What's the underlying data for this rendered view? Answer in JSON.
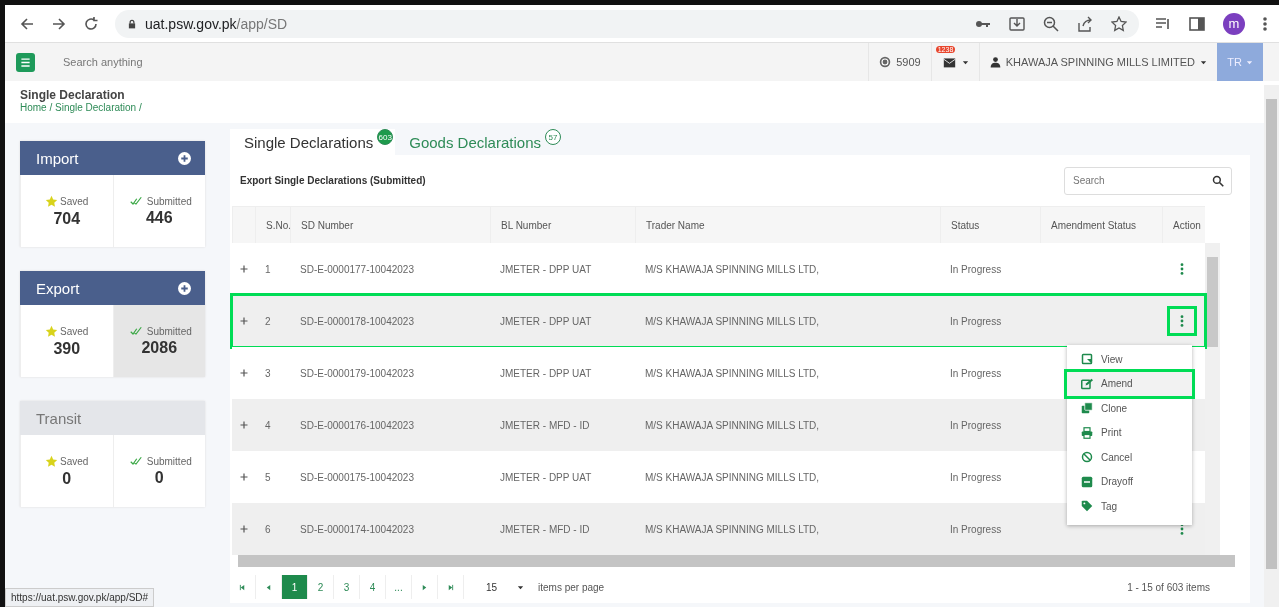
{
  "browser": {
    "url": {
      "host": "uat.psw.gov.pk",
      "path": "/app/SD"
    },
    "avatar": "m"
  },
  "header": {
    "search_placeholder": "Search anything",
    "points": "5909",
    "mail_badge": "1238",
    "user": "KHAWAJA SPINNING MILLS LIMITED",
    "language": "TR"
  },
  "page": {
    "title": "Single Declaration",
    "breadcrumb": "Home / Single Declaration /"
  },
  "sidebar": [
    {
      "title": "Import",
      "enabled": true,
      "stats": [
        {
          "label": "Saved",
          "value": "704",
          "selected": false
        },
        {
          "label": "Submitted",
          "value": "446",
          "selected": false
        }
      ]
    },
    {
      "title": "Export",
      "enabled": true,
      "stats": [
        {
          "label": "Saved",
          "value": "390",
          "selected": false
        },
        {
          "label": "Submitted",
          "value": "2086",
          "selected": true
        }
      ]
    },
    {
      "title": "Transit",
      "enabled": false,
      "stats": [
        {
          "label": "Saved",
          "value": "0",
          "selected": false
        },
        {
          "label": "Submitted",
          "value": "0",
          "selected": false
        }
      ]
    }
  ],
  "tabs": [
    {
      "label": "Single Declarations",
      "badge": "603",
      "selected": true
    },
    {
      "label": "Goods Declarations",
      "badge": "57",
      "selected": false
    }
  ],
  "table": {
    "title": "Export Single Declarations (Submitted)",
    "search_placeholder": "Search",
    "columns": [
      "S.No.",
      "SD Number",
      "BL Number",
      "Trader Name",
      "Status",
      "Amendment Status",
      "Action"
    ],
    "rows": [
      {
        "sno": "1",
        "sd_number": "SD-E-0000177-10042023",
        "bl_number": "JMETER - DPP UAT",
        "trader_name": "M/S KHAWAJA SPINNING MILLS LTD,",
        "status": "In Progress",
        "action_shown": true,
        "highlighted": false,
        "action_highlighted": false
      },
      {
        "sno": "2",
        "sd_number": "SD-E-0000178-10042023",
        "bl_number": "JMETER - DPP UAT",
        "trader_name": "M/S KHAWAJA SPINNING MILLS LTD,",
        "status": "In Progress",
        "action_shown": true,
        "highlighted": true,
        "action_highlighted": true
      },
      {
        "sno": "3",
        "sd_number": "SD-E-0000179-10042023",
        "bl_number": "JMETER - DPP UAT",
        "trader_name": "M/S KHAWAJA SPINNING MILLS LTD,",
        "status": "In Progress",
        "action_shown": false,
        "highlighted": false
      },
      {
        "sno": "4",
        "sd_number": "SD-E-0000176-10042023",
        "bl_number": "JMETER - MFD - ID",
        "trader_name": "M/S KHAWAJA SPINNING MILLS LTD,",
        "status": "In Progress",
        "action_shown": false,
        "highlighted": false
      },
      {
        "sno": "5",
        "sd_number": "SD-E-0000175-10042023",
        "bl_number": "JMETER - DPP UAT",
        "trader_name": "M/S KHAWAJA SPINNING MILLS LTD,",
        "status": "In Progress",
        "action_shown": false,
        "highlighted": false
      },
      {
        "sno": "6",
        "sd_number": "SD-E-0000174-10042023",
        "bl_number": "JMETER - MFD - ID",
        "trader_name": "M/S KHAWAJA SPINNING MILLS LTD,",
        "status": "In Progress",
        "action_shown": true,
        "highlighted": false,
        "action_highlighted": false
      }
    ]
  },
  "action_menu": {
    "items": [
      {
        "label": "View",
        "highlighted": false
      },
      {
        "label": "Amend",
        "highlighted": true
      },
      {
        "label": "Clone",
        "highlighted": false
      },
      {
        "label": "Print",
        "highlighted": false
      },
      {
        "label": "Cancel",
        "highlighted": false
      },
      {
        "label": "Drayoff",
        "highlighted": false
      },
      {
        "label": "Tag",
        "highlighted": false
      }
    ]
  },
  "pagination": {
    "pages": [
      {
        "label": "1",
        "selected": true
      },
      {
        "label": "2",
        "selected": false
      },
      {
        "label": "3",
        "selected": false
      },
      {
        "label": "4",
        "selected": false
      },
      {
        "label": "...",
        "selected": false
      }
    ],
    "page_size": "15",
    "page_size_label": "items per page",
    "summary": "1 - 15 of 603 items"
  },
  "status_url": "https://uat.psw.gov.pk/app/SD#"
}
